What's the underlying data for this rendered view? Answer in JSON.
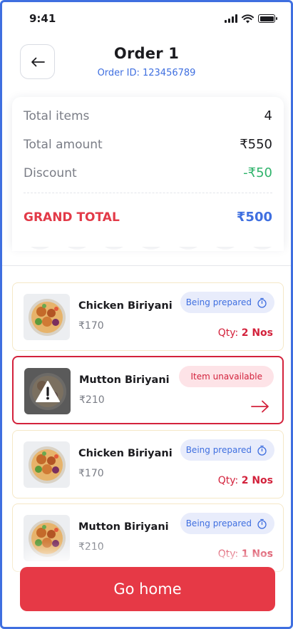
{
  "status_bar": {
    "time": "9:41"
  },
  "header": {
    "title": "Order 1",
    "order_id": "Order ID: 123456789"
  },
  "summary": {
    "total_items_label": "Total items",
    "total_items_value": "4",
    "total_amount_label": "Total amount",
    "total_amount_value": "₹550",
    "discount_label": "Discount",
    "discount_value": "-₹50",
    "grand_total_label": "GRAND TOTAL",
    "grand_total_value": "₹500"
  },
  "items": [
    {
      "name": "Chicken Biriyani",
      "price": "₹170",
      "status": "Being prepared",
      "qty_label": "Qty:",
      "qty_value": "2 Nos"
    },
    {
      "name": "Mutton Biriyani",
      "price": "₹210",
      "status": "Item unavailable"
    },
    {
      "name": "Chicken Biriyani",
      "price": "₹170",
      "status": "Being prepared",
      "qty_label": "Qty:",
      "qty_value": "2 Nos"
    },
    {
      "name": "Mutton Biriyani",
      "price": "₹210",
      "status": "Being prepared",
      "qty_label": "Qty:",
      "qty_value": "1 Nos"
    }
  ],
  "cta": {
    "label": "Go home"
  },
  "colors": {
    "accent_blue": "#3f6fe0",
    "danger_red": "#e63946",
    "discount_green": "#2fb36b"
  },
  "icons": [
    "back-arrow-icon",
    "timer-icon",
    "warning-icon",
    "arrow-right-icon",
    "signal-icon",
    "wifi-icon",
    "battery-icon"
  ]
}
